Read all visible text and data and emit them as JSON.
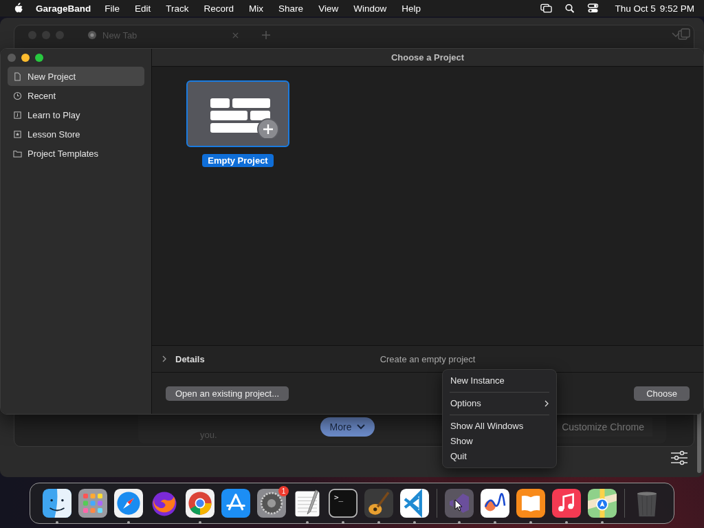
{
  "menu_bar": {
    "app_name": "GarageBand",
    "menus": [
      "File",
      "Edit",
      "Track",
      "Record",
      "Mix",
      "Share",
      "View",
      "Window",
      "Help"
    ],
    "date": "Thu Oct 5",
    "time": "9:52 PM"
  },
  "browser_window": {
    "tab_title": "New Tab",
    "body_text": "you.",
    "more_button": "More",
    "customize_button": "Customize Chrome"
  },
  "project_window": {
    "title": "Choose a Project",
    "sidebar": [
      {
        "label": "New Project",
        "kind": "document",
        "selected": true
      },
      {
        "label": "Recent",
        "kind": "clock",
        "selected": false
      },
      {
        "label": "Learn to Play",
        "kind": "note",
        "selected": false
      },
      {
        "label": "Lesson Store",
        "kind": "star",
        "selected": false
      },
      {
        "label": "Project Templates",
        "kind": "folder",
        "selected": false
      }
    ],
    "projects": [
      {
        "label": "Empty Project",
        "selected": true
      }
    ],
    "details": {
      "label": "Details",
      "expanded": false,
      "description": "Create an empty project"
    },
    "buttons": {
      "open": "Open an existing project...",
      "choose": "Choose"
    }
  },
  "context_menu": [
    {
      "kind": "item",
      "label": "New Instance"
    },
    {
      "kind": "separator"
    },
    {
      "kind": "submenu",
      "label": "Options"
    },
    {
      "kind": "separator"
    },
    {
      "kind": "item",
      "label": "Show All Windows"
    },
    {
      "kind": "item",
      "label": "Show"
    },
    {
      "kind": "item",
      "label": "Quit"
    }
  ],
  "dock": [
    {
      "kind": "finder",
      "running": true
    },
    {
      "kind": "launchpad",
      "running": false
    },
    {
      "kind": "safari",
      "running": true
    },
    {
      "kind": "firefox",
      "running": false
    },
    {
      "kind": "chrome",
      "running": true
    },
    {
      "kind": "appstore",
      "running": false
    },
    {
      "kind": "settings",
      "running": false,
      "badge": "1"
    },
    {
      "kind": "textedit",
      "running": true
    },
    {
      "kind": "terminal",
      "running": true,
      "glyph": ">_"
    },
    {
      "kind": "garageband",
      "running": true
    },
    {
      "kind": "vscode",
      "running": true
    },
    {
      "kind": "divider"
    },
    {
      "kind": "visualstudio",
      "running": true
    },
    {
      "kind": "freeform",
      "running": true
    },
    {
      "kind": "books",
      "running": true
    },
    {
      "kind": "music",
      "running": true
    },
    {
      "kind": "maps",
      "running": true
    },
    {
      "kind": "divider"
    },
    {
      "kind": "trash",
      "running": false
    }
  ]
}
